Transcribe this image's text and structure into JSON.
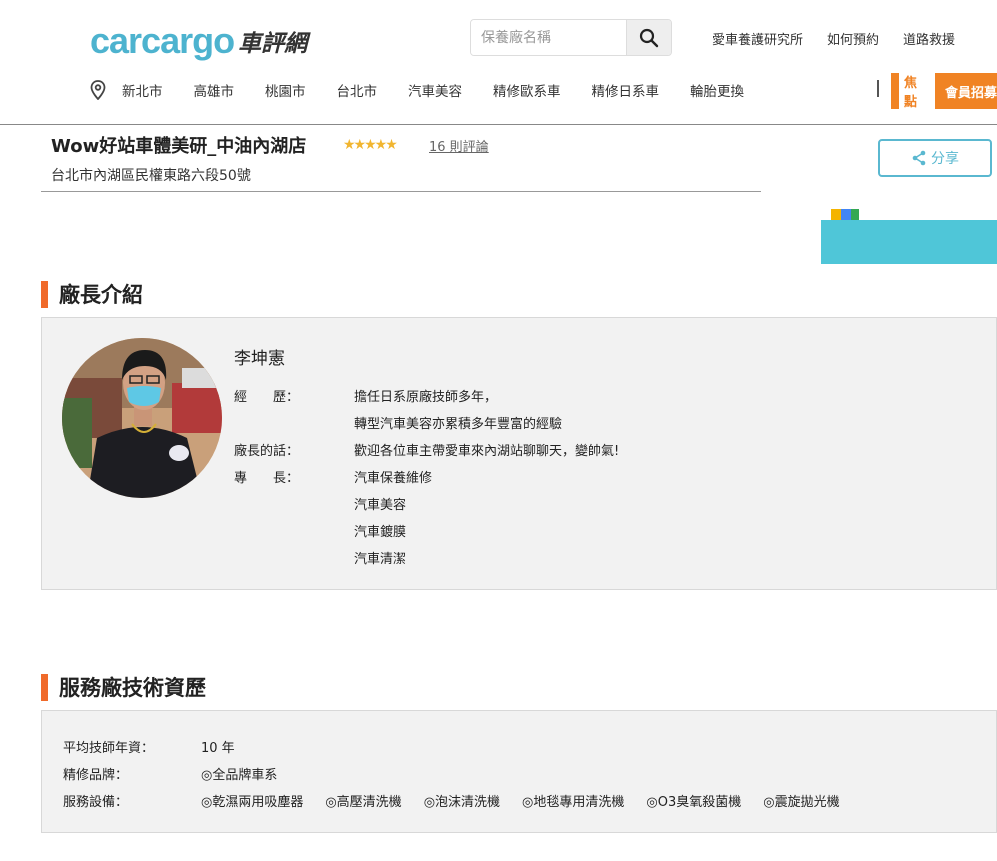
{
  "header": {
    "logo_en": "carcargo",
    "logo_zh": "車評網",
    "search_placeholder": "保養廠名稱",
    "top_links": [
      "愛車養護研究所",
      "如何預約",
      "道路救援"
    ],
    "nav_items": [
      "新北市",
      "高雄市",
      "桃園市",
      "台北市",
      "汽車美容",
      "精修歐系車",
      "精修日系車",
      "輪胎更換"
    ],
    "promo_tag": "焦點",
    "promo_text": "會員招募"
  },
  "shop": {
    "name": "Wow好站車體美研_中油內湖店",
    "rating_stars": "★★★★★",
    "review_count": "16 則評論",
    "address": "台北市內湖區民權東路六段50號",
    "share_label": "分享"
  },
  "manager_section": {
    "title": "廠長介紹",
    "name": "李坤憲",
    "experience_label": "經　　歷：",
    "experience_lines": [
      "擔任日系原廠技師多年，",
      "轉型汽車美容亦累積多年豐富的經驗"
    ],
    "quote_label": "廠長的話：",
    "quote": "歡迎各位車主帶愛車來內湖站聊聊天，變帥氣!",
    "specialty_label": "專　　長：",
    "specialties": [
      "汽車保養維修",
      "汽車美容",
      "汽車鍍膜",
      "汽車清潔"
    ]
  },
  "tech_section": {
    "title": "服務廠技術資歷",
    "avg_years_label": "平均技師年資：",
    "avg_years_value": "10 年",
    "brands_label": "精修品牌：",
    "brands_value": "◎全品牌車系",
    "equipment_label": "服務設備：",
    "equipment": [
      "◎乾濕兩用吸塵器",
      "◎高壓清洗機",
      "◎泡沫清洗機",
      "◎地毯專用清洗機",
      "◎O3臭氧殺菌機",
      "◎震旋拋光機"
    ]
  },
  "colors": {
    "logo_blue": "#4db3cf",
    "accent_orange": "#f06a2a",
    "promo_orange": "#f08324",
    "share_blue": "#5ab8d0",
    "star_gold": "#f1b530"
  }
}
